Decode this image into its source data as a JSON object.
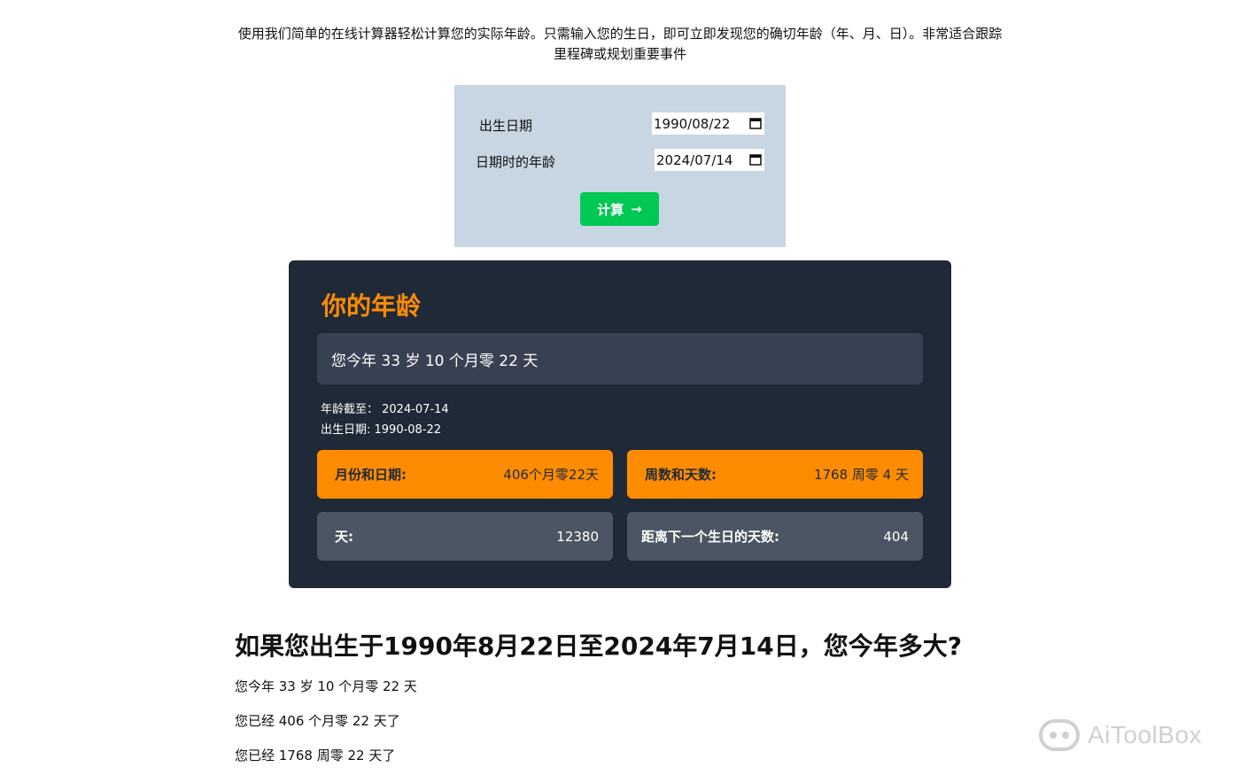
{
  "intro": {
    "text": "使用我们简单的在线计算器轻松计算您的实际年龄。只需输入您的生日，即可立即发现您的确切年龄（年、月、日）。非常适合跟踪里程碑或规划重要事件"
  },
  "form": {
    "birth_label": "出生日期",
    "birth_value": "1990/08/22",
    "age_at_label": "日期时的年龄",
    "age_at_value": "2024/07/14",
    "calc_label": "计算",
    "calc_arrow": "→"
  },
  "result": {
    "title": "你的年龄",
    "summary": "您今年 33 岁 10 个月零 22 天",
    "age_at_line": "年龄截至：  2024-07-14",
    "birth_line": "出生日期: 1990-08-22",
    "stats": [
      {
        "label": "月份和日期:",
        "value": "406个月零22天"
      },
      {
        "label": "周数和天数:",
        "value": "1768 周零 4 天"
      },
      {
        "label": "天:",
        "value": "12380"
      },
      {
        "label": "距离下一个生日的天数:",
        "value": "404"
      }
    ]
  },
  "faq": {
    "heading": "如果您出生于1990年8月22日至2024年7月14日，您今年多大?",
    "lines": [
      "您今年 33 岁 10 个月零 22 天",
      "您已经 406 个月零 22 天了",
      "您已经 1768 周零 22 天了"
    ]
  },
  "watermark": {
    "text": "AiToolBox"
  },
  "colors": {
    "accent": "#ff8c00",
    "button": "#00c853",
    "card_bg": "#1f2937",
    "form_bg": "#c8d5e3"
  }
}
